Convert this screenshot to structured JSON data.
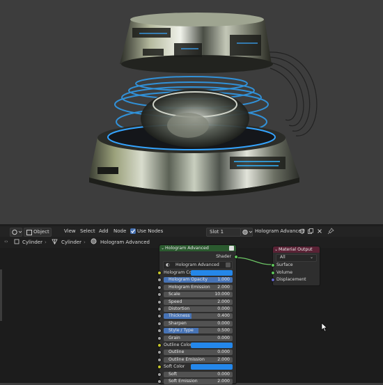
{
  "header": {
    "mode_label": "Object",
    "menu": [
      "View",
      "Select",
      "Add",
      "Node"
    ],
    "use_nodes_label": "Use Nodes",
    "slot_label": "Slot 1",
    "material_name": "Hologram Advanced"
  },
  "breadcrumb": [
    "Cylinder",
    "Cylinder",
    "Hologram Advanced"
  ],
  "group_node": {
    "title": "Hologram Advanced",
    "output_label": "Shader",
    "group_name": "Hologram Advanced",
    "rows": [
      {
        "label": "Hologram Color",
        "kind": "color",
        "color": "#2487ea"
      },
      {
        "label": "Hologram Opacity",
        "kind": "value",
        "value": "1.000",
        "fill": 1.0,
        "highlight": true
      },
      {
        "label": "Hologram Emission",
        "kind": "value",
        "value": "2.000",
        "fill": 0
      },
      {
        "label": "Scale",
        "kind": "value",
        "value": "10.000",
        "fill": 0
      },
      {
        "label": "Speed",
        "kind": "value",
        "value": "2.000",
        "fill": 0
      },
      {
        "label": "Distortion",
        "kind": "value",
        "value": "0.000",
        "fill": 0
      },
      {
        "label": "Thickness",
        "kind": "value",
        "value": "0.400",
        "fill": 0.4
      },
      {
        "label": "Sharpen",
        "kind": "value",
        "value": "0.000",
        "fill": 0
      },
      {
        "label": "Style / Type",
        "kind": "value",
        "value": "0.500",
        "fill": 0.5
      },
      {
        "label": "Grain",
        "kind": "value",
        "value": "0.000",
        "fill": 0
      },
      {
        "label": "Outline Color",
        "kind": "color",
        "color": "#2487ea"
      },
      {
        "label": "Outline",
        "kind": "value",
        "value": "0.000",
        "fill": 0
      },
      {
        "label": "Outline Emission",
        "kind": "value",
        "value": "2.000",
        "fill": 0
      },
      {
        "label": "Soft Color",
        "kind": "color",
        "color": "#2487ea"
      },
      {
        "label": "Soft",
        "kind": "value",
        "value": "0.000",
        "fill": 0
      },
      {
        "label": "Soft Emission",
        "kind": "value",
        "value": "2.000",
        "fill": 0
      }
    ]
  },
  "material_output": {
    "title": "Material Output",
    "target": "All",
    "inputs": [
      "Surface",
      "Volume",
      "Displacement"
    ]
  },
  "colors": {
    "group_header": "#2b5a2f",
    "output_header": "#5a2235",
    "accent": "#4773b5",
    "shader_socket": "#5ec45a",
    "vector_socket": "#6363c7"
  }
}
